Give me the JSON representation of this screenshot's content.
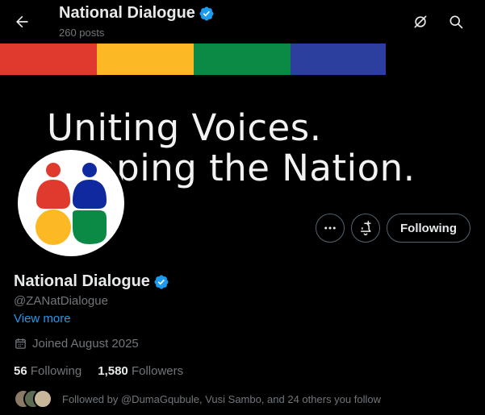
{
  "header": {
    "title": "National Dialogue",
    "posts_count": "260 posts",
    "back_icon": "arrow-left-icon",
    "grok_icon": "grok-icon",
    "search_icon": "search-icon"
  },
  "banner": {
    "line1": "Uniting Voices.",
    "line2": "Shaping the Nation.",
    "stripe_colors": [
      "#e03a2f",
      "#fdb924",
      "#0a8a44",
      "#2c3f9e"
    ]
  },
  "profile": {
    "name": "National Dialogue",
    "handle": "@ZANatDialogue",
    "verified": true,
    "view_more": "View more",
    "joined": "Joined August 2025",
    "following_count": "56",
    "following_label": "Following",
    "followers_count": "1,580",
    "followers_label": "Followers",
    "followed_by": "Followed by @DumaGqubule, Vusi Sambo, and 24 others you follow"
  },
  "actions": {
    "more_icon": "more-icon",
    "notify_icon": "bell-plus-icon",
    "following_button": "Following"
  },
  "colors": {
    "accent": "#1d9bf0",
    "verified": "#1d9bf0",
    "muted_text": "#71767b",
    "background": "#000000"
  }
}
